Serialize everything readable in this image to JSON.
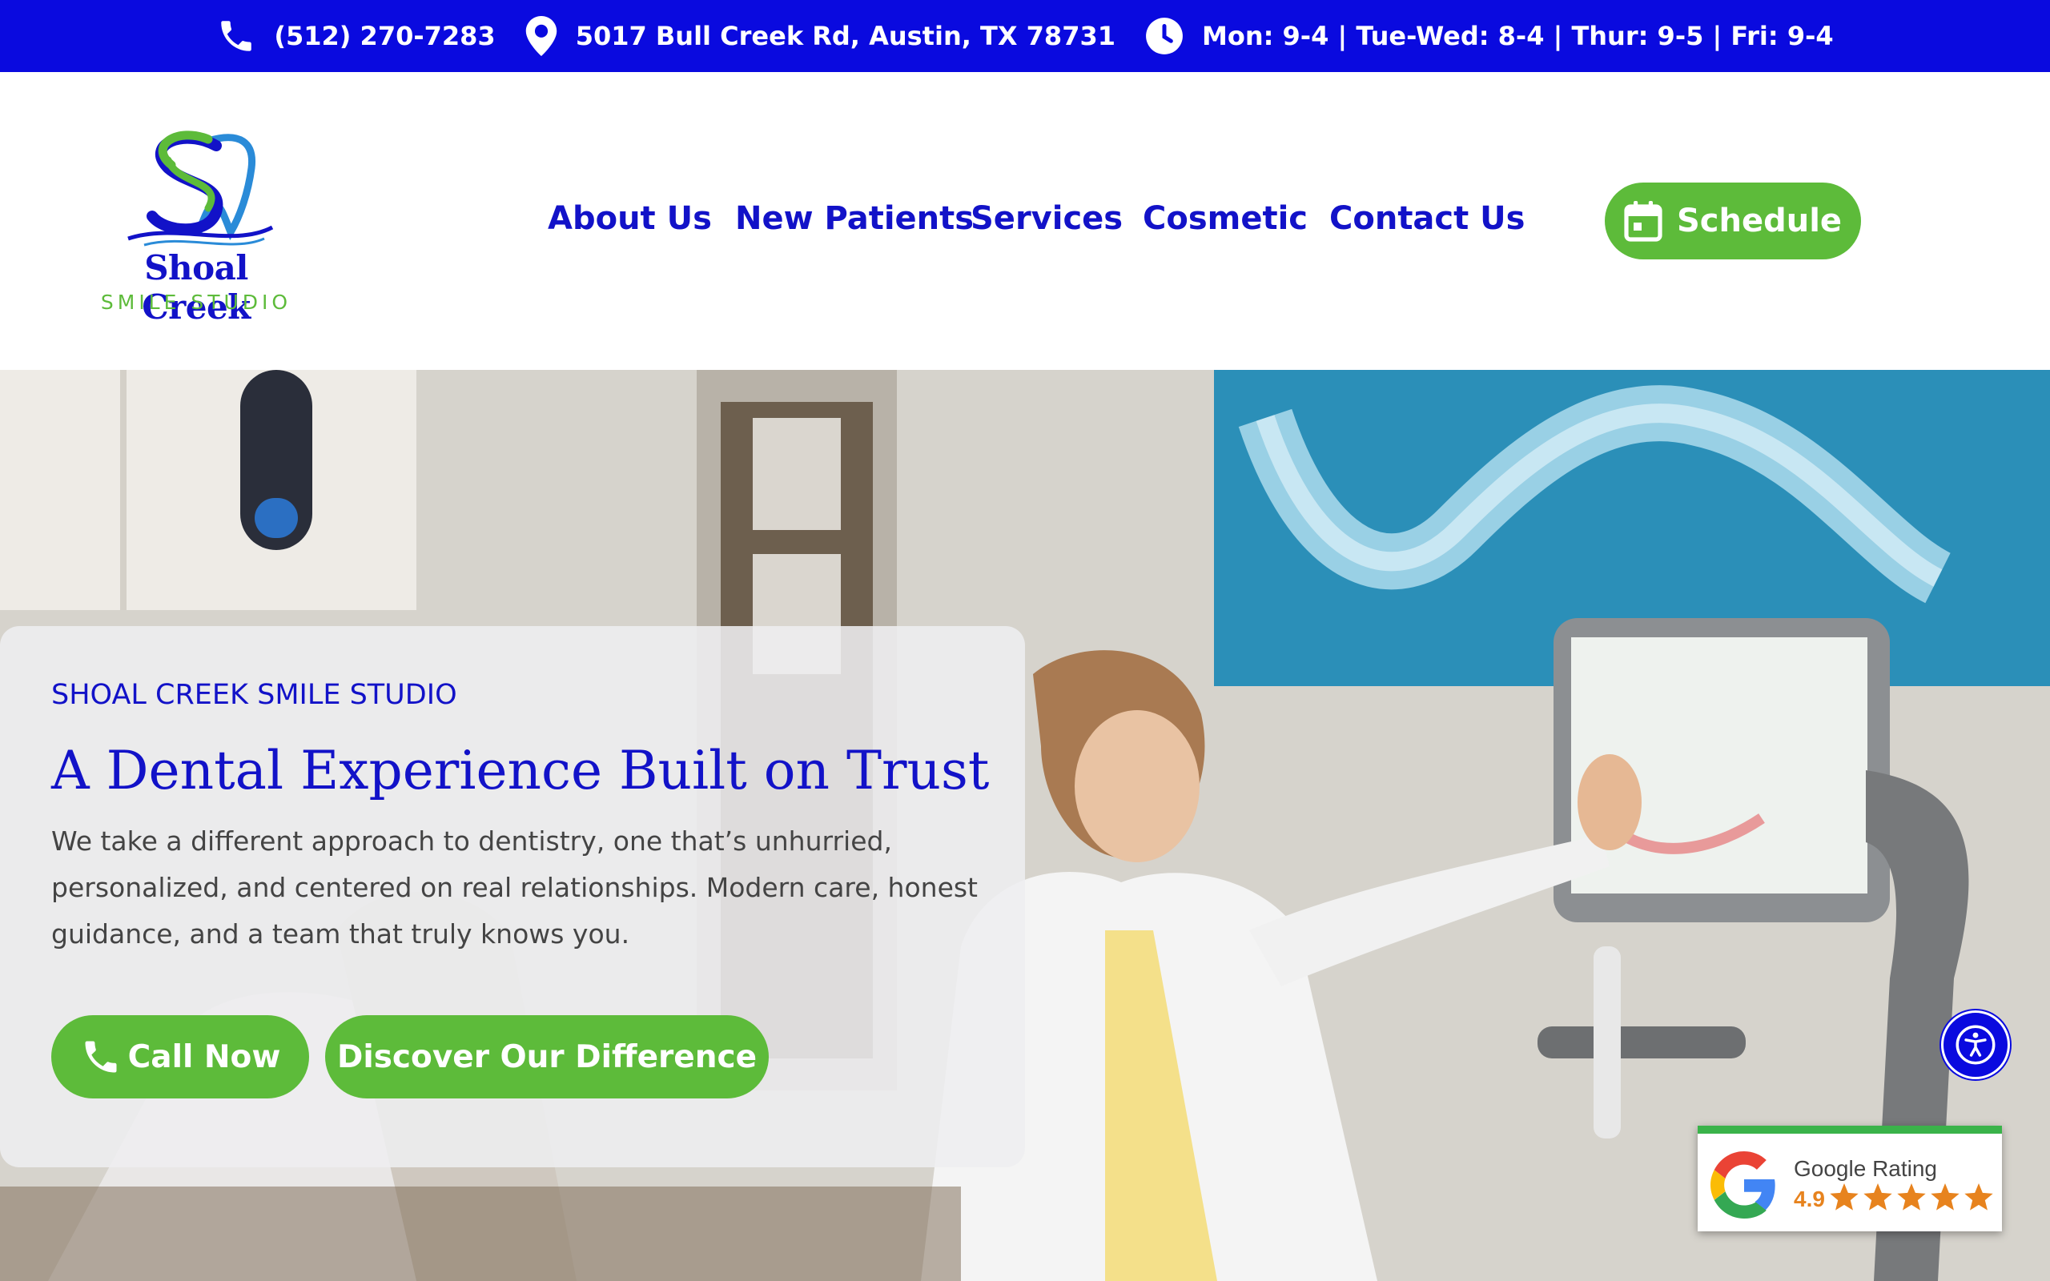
{
  "topbar": {
    "phone": "(512) 270-7283",
    "address": "5017 Bull Creek Rd, Austin, TX 78731",
    "hours": "Mon: 9-4 | Tue-Wed: 8-4 | Thur: 9-5 | Fri: 9-4",
    "icons": [
      "phone-icon",
      "map-pin-icon",
      "clock-icon"
    ]
  },
  "logo": {
    "name": "Shoal Creek",
    "tagline": "SMILE STUDIO"
  },
  "nav": {
    "items": [
      "About Us",
      "New Patients",
      "Services",
      "Cosmetic",
      "Contact Us"
    ],
    "schedule_label": "Schedule"
  },
  "hero": {
    "eyebrow": "SHOAL CREEK SMILE STUDIO",
    "headline": "A Dental Experience Built on Trust",
    "body": "We take a different approach to dentistry, one that’s unhurried, personalized, and centered on real relationships. Modern care, honest guidance, and a team that truly knows you.",
    "call_label": "Call Now",
    "discover_label": "Discover Our Difference"
  },
  "google_rating": {
    "title": "Google Rating",
    "score": "4.9",
    "stars": 5
  },
  "colors": {
    "brand_blue": "#0a0adf",
    "heading_blue": "#1212c8",
    "accent_green": "#5dbb3a",
    "rating_orange": "#e7831e"
  }
}
